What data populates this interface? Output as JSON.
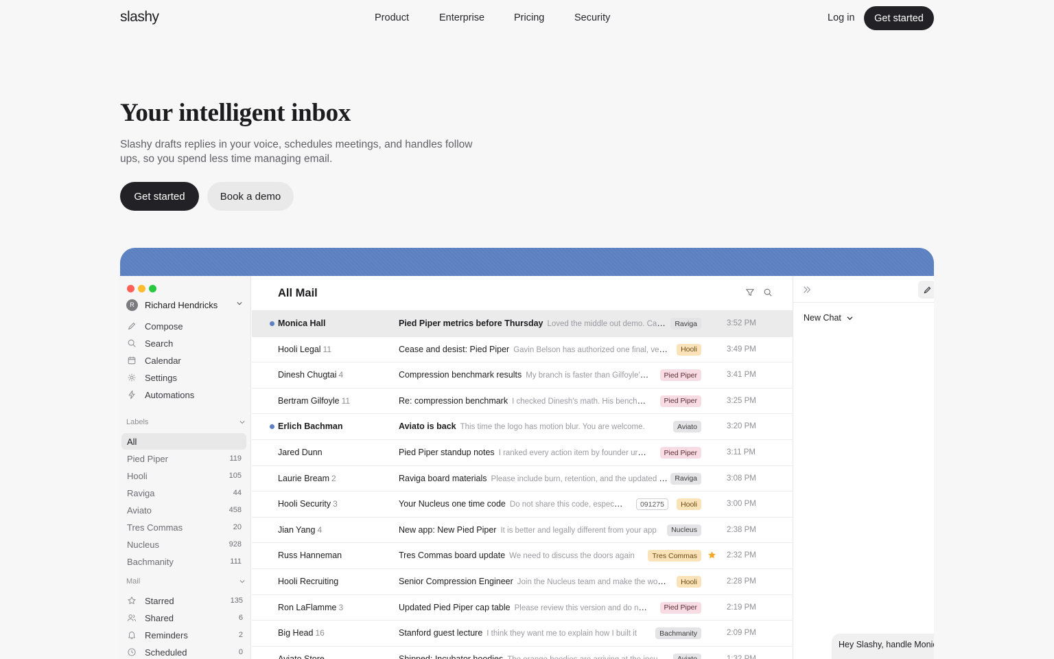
{
  "nav": {
    "logo": "slashy",
    "links": [
      "Product",
      "Enterprise",
      "Pricing",
      "Security"
    ],
    "login": "Log in",
    "cta": "Get started"
  },
  "hero": {
    "title": "Your intelligent inbox",
    "subtitle": "Slashy drafts replies in your voice, schedules meetings, and handles follow ups, so you spend less time managing email.",
    "primary_cta": "Get started",
    "secondary_cta": "Book a demo"
  },
  "colors": {
    "accent": "#5b7fc1",
    "dark": "#222226"
  },
  "app": {
    "account": {
      "initial": "R",
      "name": "Richard Hendricks"
    },
    "menu": [
      {
        "label": "Compose",
        "icon": "pencil-icon"
      },
      {
        "label": "Search",
        "icon": "search-icon"
      },
      {
        "label": "Calendar",
        "icon": "calendar-icon"
      },
      {
        "label": "Settings",
        "icon": "gear-icon"
      },
      {
        "label": "Automations",
        "icon": "bolt-icon"
      }
    ],
    "labels_heading": "Labels",
    "labels": [
      {
        "name": "All",
        "count": ""
      },
      {
        "name": "Pied Piper",
        "count": "119"
      },
      {
        "name": "Hooli",
        "count": "105"
      },
      {
        "name": "Raviga",
        "count": "44"
      },
      {
        "name": "Aviato",
        "count": "458"
      },
      {
        "name": "Tres Commas",
        "count": "20"
      },
      {
        "name": "Nucleus",
        "count": "928"
      },
      {
        "name": "Bachmanity",
        "count": "111"
      }
    ],
    "mail_heading": "Mail",
    "mail": [
      {
        "name": "Starred",
        "count": "135",
        "icon": "star-outline-icon"
      },
      {
        "name": "Shared",
        "count": "6",
        "icon": "users-icon"
      },
      {
        "name": "Reminders",
        "count": "2",
        "icon": "bell-icon"
      },
      {
        "name": "Scheduled",
        "count": "0",
        "icon": "clock-icon"
      }
    ],
    "list_title": "All Mail",
    "emails": [
      {
        "sender": "Monica Hall",
        "thread": "",
        "unread": true,
        "subject": "Pied Piper metrics before Thursday",
        "preview": "Loved the middle out demo. Can you send over the numbers?",
        "tag": "Raviga",
        "code": "",
        "starred": false,
        "time": "3:52 PM"
      },
      {
        "sender": "Hooli Legal",
        "thread": "11",
        "unread": false,
        "subject": "Cease and desist: Pied Piper",
        "preview": "Gavin Belson has authorized one final, very serious warning",
        "tag": "Hooli",
        "code": "",
        "starred": false,
        "time": "3:49 PM"
      },
      {
        "sender": "Dinesh Chugtai",
        "thread": "4",
        "unread": false,
        "subject": "Compression benchmark results",
        "preview": "My branch is faster than Gilfoyle's branch",
        "tag": "Pied Piper",
        "code": "",
        "starred": false,
        "time": "3:41 PM"
      },
      {
        "sender": "Bertram Gilfoyle",
        "thread": "11",
        "unread": false,
        "subject": "Re: compression benchmark",
        "preview": "I checked Dinesh's math. His benchmark is wrong",
        "tag": "Pied Piper",
        "code": "",
        "starred": false,
        "time": "3:25 PM"
      },
      {
        "sender": "Erlich Bachman",
        "thread": "",
        "unread": true,
        "subject": "Aviato is back",
        "preview": "This time the logo has motion blur. You are welcome.",
        "tag": "Aviato",
        "code": "",
        "starred": false,
        "time": "3:20 PM"
      },
      {
        "sender": "Jared Dunn",
        "thread": "",
        "unread": false,
        "subject": "Pied Piper standup notes",
        "preview": "I ranked every action item by founder urgency",
        "tag": "Pied Piper",
        "code": "",
        "starred": false,
        "time": "3:11 PM"
      },
      {
        "sender": "Laurie Bream",
        "thread": "2",
        "unread": false,
        "subject": "Raviga board materials",
        "preview": "Please include burn, retention, and the updated forecast",
        "tag": "Raviga",
        "code": "",
        "starred": false,
        "time": "3:08 PM"
      },
      {
        "sender": "Hooli Security",
        "thread": "3",
        "unread": false,
        "subject": "Your Nucleus one time code",
        "preview": "Do not share this code, especially with Pied Piper",
        "tag": "Hooli",
        "code": "091275",
        "starred": false,
        "time": "3:00 PM"
      },
      {
        "sender": "Jian Yang",
        "thread": "4",
        "unread": false,
        "subject": "New app: New Pied Piper",
        "preview": "It is better and legally different from your app",
        "tag": "Nucleus",
        "code": "",
        "starred": false,
        "time": "2:38 PM"
      },
      {
        "sender": "Russ Hanneman",
        "thread": "",
        "unread": false,
        "subject": "Tres Commas board update",
        "preview": "We need to discuss the doors again",
        "tag": "Tres Commas",
        "code": "",
        "starred": true,
        "time": "2:32 PM"
      },
      {
        "sender": "Hooli Recruiting",
        "thread": "",
        "unread": false,
        "subject": "Senior Compression Engineer",
        "preview": "Join the Nucleus team and make the world a better place",
        "tag": "Hooli",
        "code": "",
        "starred": false,
        "time": "2:28 PM"
      },
      {
        "sender": "Ron LaFlamme",
        "thread": "3",
        "unread": false,
        "subject": "Updated Pied Piper cap table",
        "preview": "Please review this version and do not forward it",
        "tag": "Pied Piper",
        "code": "",
        "starred": false,
        "time": "2:19 PM"
      },
      {
        "sender": "Big Head",
        "thread": "16",
        "unread": false,
        "subject": "Stanford guest lecture",
        "preview": "I think they want me to explain how I built it",
        "tag": "Bachmanity",
        "code": "",
        "starred": false,
        "time": "2:09 PM"
      },
      {
        "sender": "Aviato Store",
        "thread": "",
        "unread": false,
        "subject": "Shipped: Incubator hoodies",
        "preview": "The orange hoodies are arriving at the incubator",
        "tag": "Aviato",
        "code": "",
        "starred": false,
        "time": "1:32 PM"
      }
    ],
    "tag_colors": {
      "Raviga": {
        "bg": "#e4e4e6",
        "fg": "#3a3a3f"
      },
      "Hooli": {
        "bg": "#fbe3b9",
        "fg": "#6b4a12"
      },
      "Pied Piper": {
        "bg": "#f7dde3",
        "fg": "#5b2a36"
      },
      "Aviato": {
        "bg": "#e4e4e6",
        "fg": "#3a3a3f"
      },
      "Nucleus": {
        "bg": "#e4e4e6",
        "fg": "#3a3a3f"
      },
      "Tres Commas": {
        "bg": "#fbe3b9",
        "fg": "#6b4a12"
      },
      "Bachmanity": {
        "bg": "#e4e4e6",
        "fg": "#3a3a3f"
      }
    },
    "chat": {
      "new_chat": "New Chat",
      "message": "Hey Slashy, handle Monica and get us ready for Thursday"
    }
  }
}
